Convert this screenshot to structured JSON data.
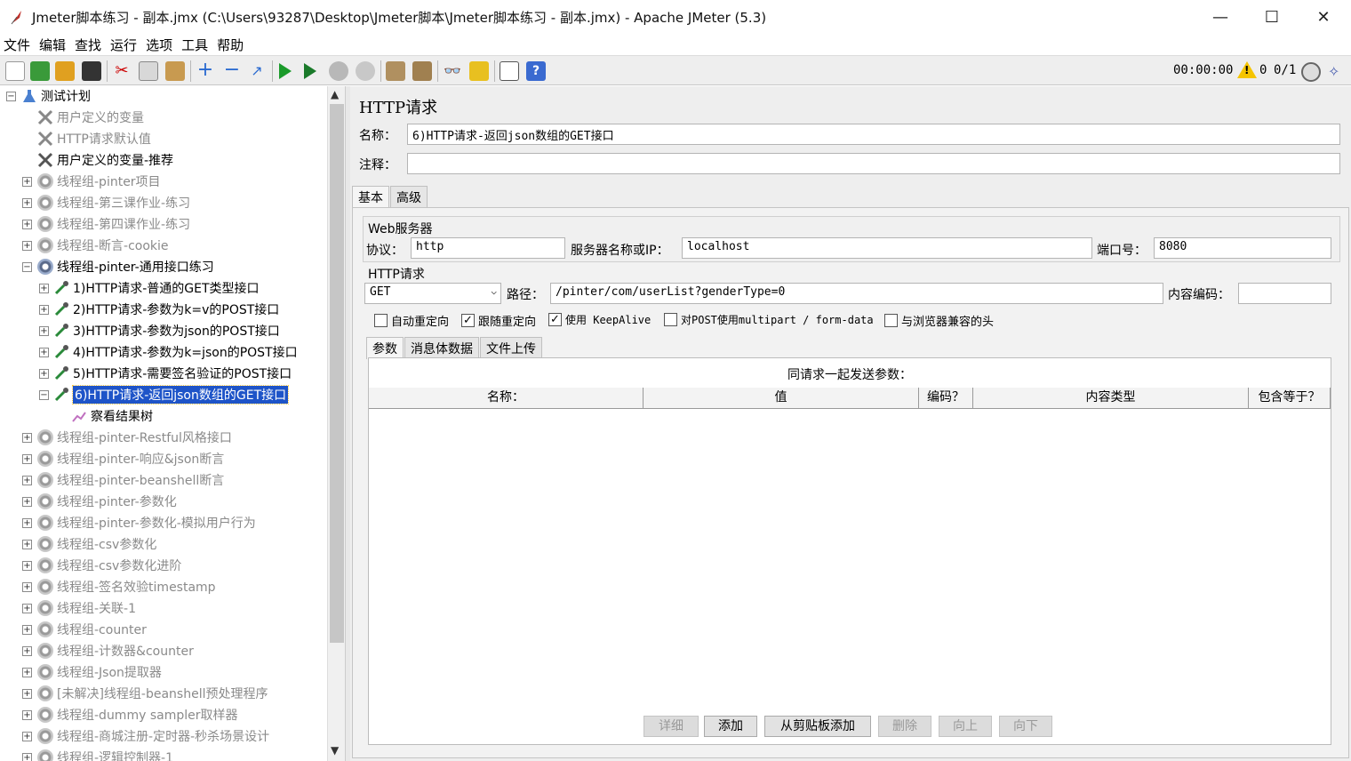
{
  "window": {
    "title": "Jmeter脚本练习 - 副本.jmx (C:\\Users\\93287\\Desktop\\Jmeter脚本\\Jmeter脚本练习 - 副本.jmx) - Apache JMeter (5.3)",
    "minimize": "—",
    "maximize": "☐",
    "close": "✕"
  },
  "menu": [
    "文件",
    "编辑",
    "查找",
    "运行",
    "选项",
    "工具",
    "帮助"
  ],
  "status": {
    "timer": "00:00:00",
    "errors": "0",
    "threads": "0/1"
  },
  "tree": {
    "root": "测试计划",
    "items": [
      "用户定义的变量",
      "HTTP请求默认值",
      "用户定义的变量-推荐",
      "线程组-pinter项目",
      "线程组-第三课作业-练习",
      "线程组-第四课作业-练习",
      "线程组-断言-cookie",
      "线程组-pinter-通用接口练习",
      "1)HTTP请求-普通的GET类型接口",
      "2)HTTP请求-参数为k=v的POST接口",
      "3)HTTP请求-参数为json的POST接口",
      "4)HTTP请求-参数为k=json的POST接口",
      "5)HTTP请求-需要签名验证的POST接口",
      "6)HTTP请求-返回json数组的GET接口",
      "察看结果树",
      "线程组-pinter-Restful风格接口",
      "线程组-pinter-响应&json断言",
      "线程组-pinter-beanshell断言",
      "线程组-pinter-参数化",
      "线程组-pinter-参数化-模拟用户行为",
      "线程组-csv参数化",
      "线程组-csv参数化进阶",
      "线程组-签名效验timestamp",
      "线程组-关联-1",
      "线程组-counter",
      "线程组-计数器&counter",
      "线程组-Json提取器",
      "[未解决]线程组-beanshell预处理程序",
      "线程组-dummy sampler取样器",
      "线程组-商城注册-定时器-秒杀场景设计",
      "线程组-逻辑控制器-1"
    ]
  },
  "panel": {
    "title": "HTTP请求",
    "name_label": "名称：",
    "name_value": "6)HTTP请求-返回json数组的GET接口",
    "comment_label": "注释：",
    "comment_value": "",
    "tabs": [
      "基本",
      "高级"
    ],
    "web_server": {
      "title": "Web服务器",
      "protocol_label": "协议：",
      "protocol": "http",
      "server_label": "服务器名称或IP：",
      "server": "localhost",
      "port_label": "端口号：",
      "port": "8080"
    },
    "http_request": {
      "title": "HTTP请求",
      "method": "GET",
      "path_label": "路径：",
      "path": "/pinter/com/userList?genderType=0",
      "encoding_label": "内容编码：",
      "encoding": ""
    },
    "options": [
      {
        "label": "自动重定向",
        "checked": false
      },
      {
        "label": "跟随重定向",
        "checked": true
      },
      {
        "label": "使用 KeepAlive",
        "checked": true
      },
      {
        "label": "对POST使用multipart / form-data",
        "checked": false
      },
      {
        "label": "与浏览器兼容的头",
        "checked": false
      }
    ],
    "subtabs": [
      "参数",
      "消息体数据",
      "文件上传"
    ],
    "params_caption": "同请求一起发送参数：",
    "columns": [
      "名称：",
      "值",
      "编码？",
      "内容类型",
      "包含等于？"
    ],
    "buttons": [
      "详细",
      "添加",
      "从剪贴板添加",
      "删除",
      "向上",
      "向下"
    ]
  }
}
